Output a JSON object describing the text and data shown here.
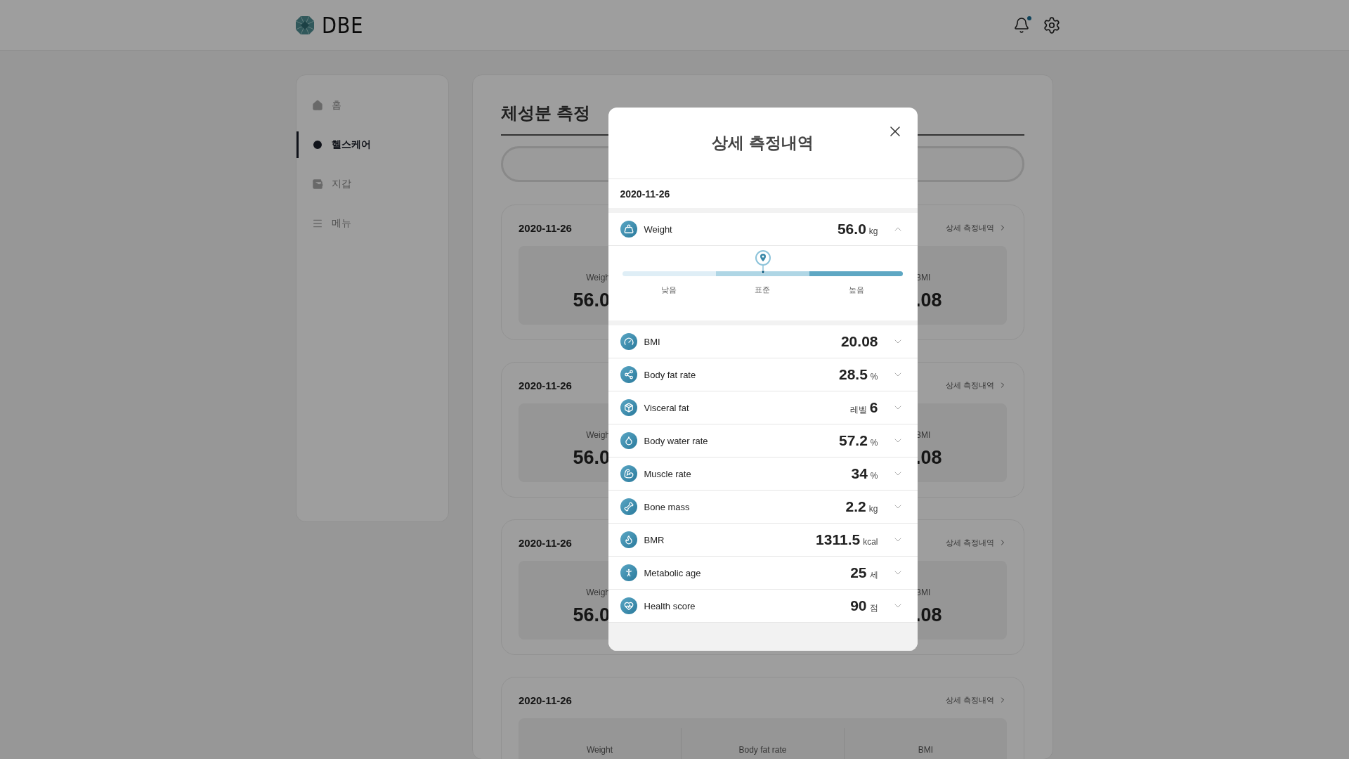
{
  "header": {
    "logo": "DBE",
    "notification_dot": true
  },
  "sidebar": {
    "items": [
      {
        "label": "홈",
        "selected": false
      },
      {
        "label": "헬스케어",
        "selected": true
      },
      {
        "label": "지갑",
        "selected": false
      },
      {
        "label": "메뉴",
        "selected": false
      }
    ]
  },
  "main": {
    "title": "체성분 측정",
    "cards": [
      {
        "date": "2020-11-26",
        "link": "상세 측정내역",
        "columns": [
          {
            "label": "Weigh",
            "value": "56.0"
          },
          {
            "label": "BMI",
            "value": ".08"
          }
        ]
      },
      {
        "date": "2020-11-26",
        "link": "상세 측정내역",
        "columns": [
          {
            "label": "Weigh",
            "value": "56.0"
          },
          {
            "label": "BMI",
            "value": ".08"
          }
        ]
      },
      {
        "date": "2020-11-26",
        "link": "상세 측정내역",
        "columns": [
          {
            "label": "Weigh",
            "value": "56.0"
          },
          {
            "label": "BMI",
            "value": ".08"
          }
        ]
      },
      {
        "date": "2020-11-26",
        "link": "상세 측정내역",
        "columns": [
          {
            "label": "Weight"
          },
          {
            "label": "Body fat rate"
          },
          {
            "label": "BMI"
          }
        ]
      }
    ]
  },
  "modal": {
    "title": "상세 측정내역",
    "date": "2020-11-26",
    "metrics": [
      {
        "name": "Weight",
        "value": "56.0",
        "unit": "kg",
        "expanded": true,
        "gauge": {
          "labels": [
            "낮음",
            "표준",
            "높음"
          ],
          "level": 0.5
        }
      },
      {
        "name": "BMI",
        "value": "20.08",
        "expanded": false
      },
      {
        "name": "Body fat rate",
        "value": "28.5",
        "unit": "%",
        "expanded": false
      },
      {
        "name": "Visceral fat",
        "prefix": "레벨",
        "value": "6",
        "expanded": false
      },
      {
        "name": "Body water rate",
        "value": "57.2",
        "unit": "%",
        "expanded": false
      },
      {
        "name": "Muscle rate",
        "value": "34",
        "unit": "%",
        "expanded": false
      },
      {
        "name": "Bone mass",
        "value": "2.2",
        "unit": "kg",
        "expanded": false
      },
      {
        "name": "BMR",
        "value": "1311.5",
        "unit": "kcal",
        "expanded": false
      },
      {
        "name": "Metabolic age",
        "value": "25",
        "unit": "세",
        "expanded": false
      },
      {
        "name": "Health score",
        "value": "90",
        "unit": "점",
        "expanded": false
      }
    ]
  }
}
